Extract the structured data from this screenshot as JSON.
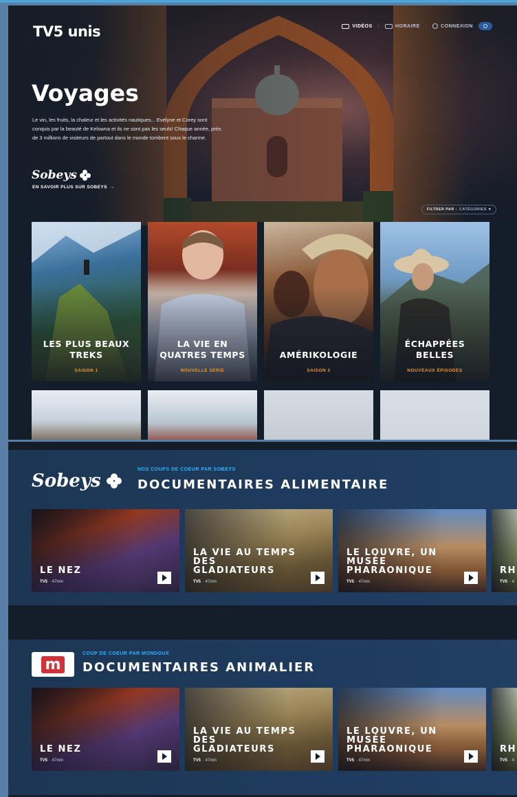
{
  "header": {
    "logo": "TV5 unis",
    "nav": [
      {
        "label": "VIDÉOS",
        "icon": "video-icon"
      },
      {
        "label": "HORAIRE",
        "icon": "tv-icon"
      },
      {
        "label": "CONNEXION",
        "icon": "user-icon"
      }
    ]
  },
  "hero": {
    "title": "Voyages",
    "description": "Le vin, les fruits, la chaleur et les activités nautiques... Evelyne et Corey sont conquis par la beauté de Kelowna et ils ne sont pas les seuls! Chaque année, près de 3 millions de visiteurs de partout dans le monde tombent sous le charme.",
    "sponsor": "Sobeys",
    "sponsor_link": "EN SAVOIR PLUS SUR SOBEYS"
  },
  "filter": {
    "label": "FILTRER PAR :",
    "value": "CATÉGORIES"
  },
  "shows": [
    {
      "title": "LES PLUS BEAUX TREKS",
      "subtitle": "SAISON 1"
    },
    {
      "title": "LA VIE EN QUATRES TEMPS",
      "subtitle": "NOUVELLE SÉRIE"
    },
    {
      "title": "AMÉRIKOLOGIE",
      "subtitle": "SAISON 2"
    },
    {
      "title": "ÉCHAPPÉES BELLES",
      "subtitle": "NOUVEAUX ÉPISODES"
    }
  ],
  "sections": [
    {
      "brand": "Sobeys",
      "kicker": "NOS COUPS DE COEUR PAR SOBEYS",
      "title": "DOCUMENTAIRES ALIMENTAIRE",
      "tiles": [
        {
          "title": "LE NEZ",
          "channel": "TV5",
          "duration": "· 47min"
        },
        {
          "title": "LA VIE AU TEMPS DES GLADIATEURS",
          "channel": "TV5",
          "duration": "· 47min"
        },
        {
          "title": "LE LOUVRE, UN MUSÉE PHARAONIQUE",
          "channel": "TV5",
          "duration": "· 47min"
        },
        {
          "title": "RH",
          "channel": "TV5",
          "duration": "· 4"
        }
      ]
    },
    {
      "brand": "m",
      "kicker": "COUP DE COEUR PAR MONDOUX",
      "title": "DOCUMENTAIRES ANIMALIER",
      "tiles": [
        {
          "title": "LE NEZ",
          "channel": "TV5",
          "duration": "· 47min"
        },
        {
          "title": "LA VIE AU TEMPS DES GLADIATEURS",
          "channel": "TV5",
          "duration": "· 47min"
        },
        {
          "title": "LE LOUVRE, UN MUSÉE PHARAONIQUE",
          "channel": "TV5",
          "duration": "· 47min"
        },
        {
          "title": "RH",
          "channel": "TV5",
          "duration": "· 4"
        }
      ]
    }
  ],
  "colors": {
    "accent_orange": "#f29a21",
    "accent_blue": "#2fb3ff",
    "background": "#141d2a"
  }
}
